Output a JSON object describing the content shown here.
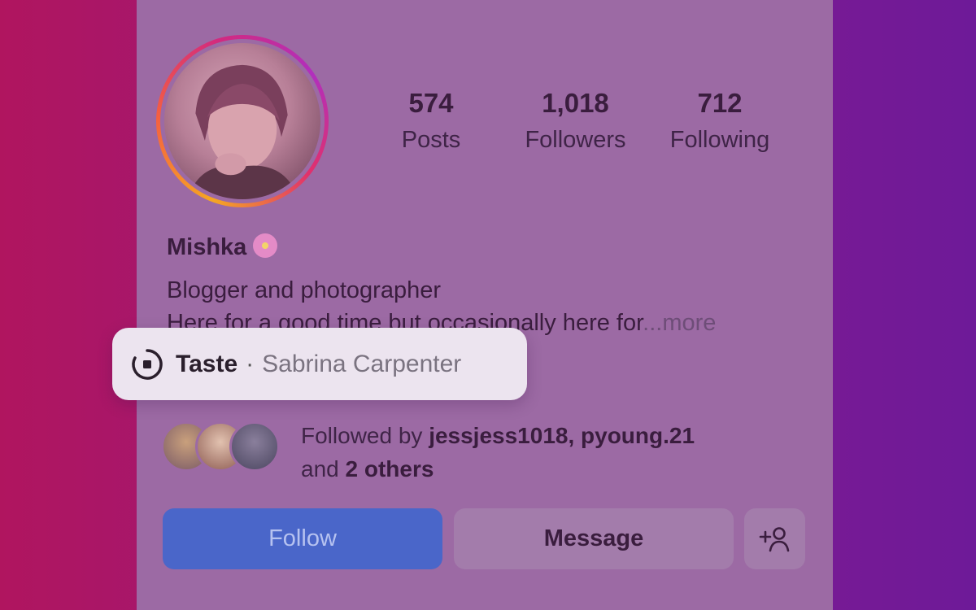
{
  "profile": {
    "stats": [
      {
        "value": "574",
        "label": "Posts"
      },
      {
        "value": "1,018",
        "label": "Followers"
      },
      {
        "value": "712",
        "label": "Following"
      }
    ],
    "name": "Mishka",
    "bio_line1": "Blogger and photographer",
    "bio_line2": "Here for a good time but occasionally here for",
    "bio_more": "...more"
  },
  "music": {
    "song": "Taste",
    "separator": "·",
    "artist": "Sabrina Carpenter"
  },
  "followed_by": {
    "prefix": "Followed by",
    "users": "jessjess1018, pyoung.21",
    "and": "and",
    "others": "2 others"
  },
  "actions": {
    "follow_label": "Follow",
    "message_label": "Message"
  },
  "icons": {
    "music": "music-player-icon",
    "add_user": "add-user-icon"
  },
  "colors": {
    "follow_button": "#4a66c9"
  }
}
